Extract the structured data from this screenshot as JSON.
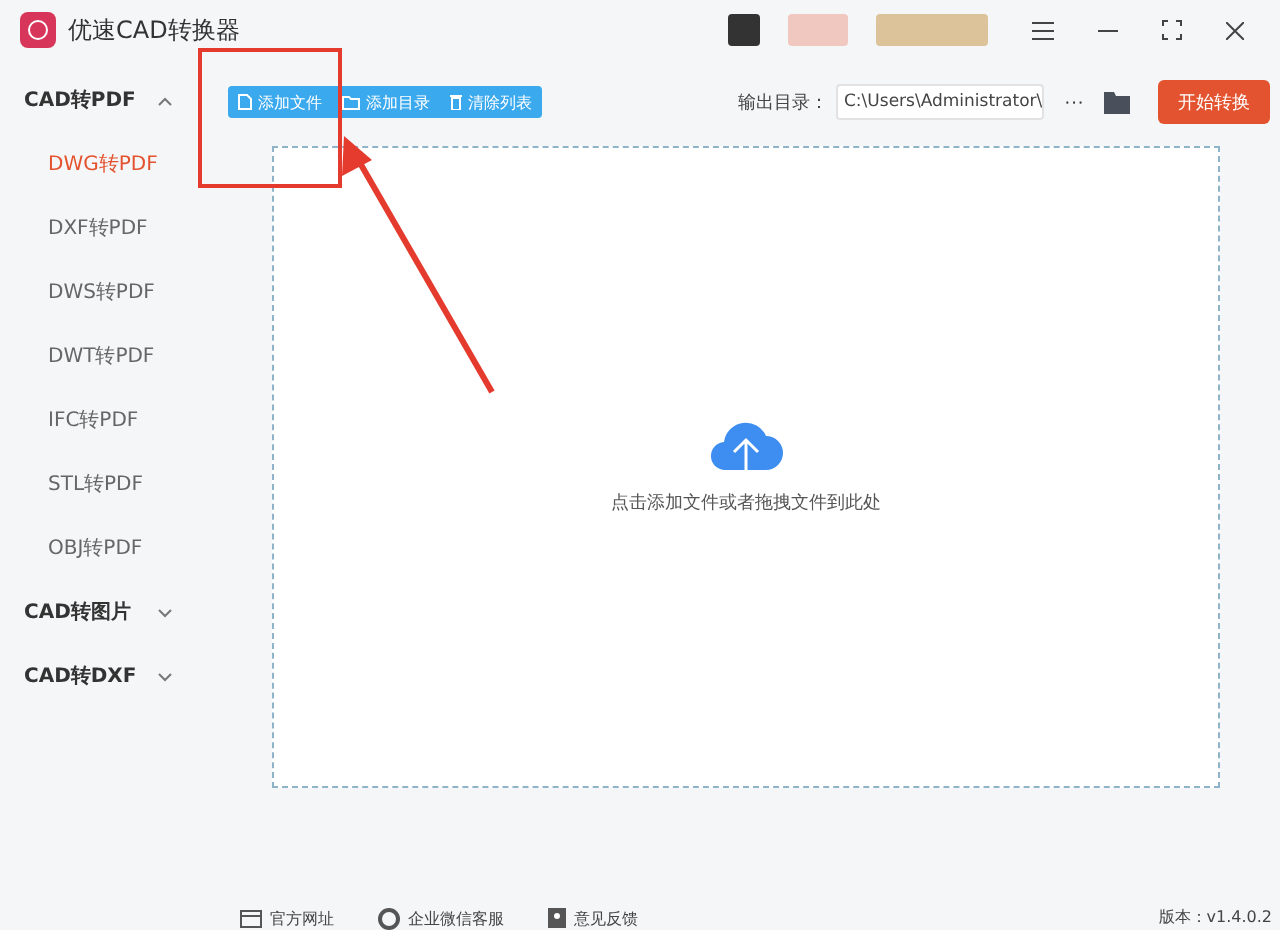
{
  "window": {
    "title": "优速CAD转换器"
  },
  "sidebar": {
    "groups": [
      {
        "label": "CAD转PDF",
        "expanded": true,
        "items": [
          {
            "label": "DWG转PDF",
            "selected": true
          },
          {
            "label": "DXF转PDF",
            "selected": false
          },
          {
            "label": "DWS转PDF",
            "selected": false
          },
          {
            "label": "DWT转PDF",
            "selected": false
          },
          {
            "label": "IFC转PDF",
            "selected": false
          },
          {
            "label": "STL转PDF",
            "selected": false
          },
          {
            "label": "OBJ转PDF",
            "selected": false
          }
        ]
      },
      {
        "label": "CAD转图片",
        "expanded": false
      },
      {
        "label": "CAD转DXF",
        "expanded": false
      }
    ]
  },
  "toolbar": {
    "buttons": [
      {
        "kind": "file",
        "label": "添加文件"
      },
      {
        "kind": "folder",
        "label": "添加目录"
      },
      {
        "kind": "trash",
        "label": "清除列表"
      }
    ],
    "output_label": "输出目录：",
    "output_path": "C:\\Users\\Administrator\\",
    "more": "···",
    "start_button": "开始转换"
  },
  "drop_zone": {
    "hint": "点击添加文件或者拖拽文件到此处"
  },
  "footer": {
    "links": [
      {
        "kind": "web",
        "label": "官方网址"
      },
      {
        "kind": "chat",
        "label": "企业微信客服"
      },
      {
        "kind": "feedback",
        "label": "意见反馈"
      }
    ],
    "version": "版本：v1.4.0.2"
  }
}
